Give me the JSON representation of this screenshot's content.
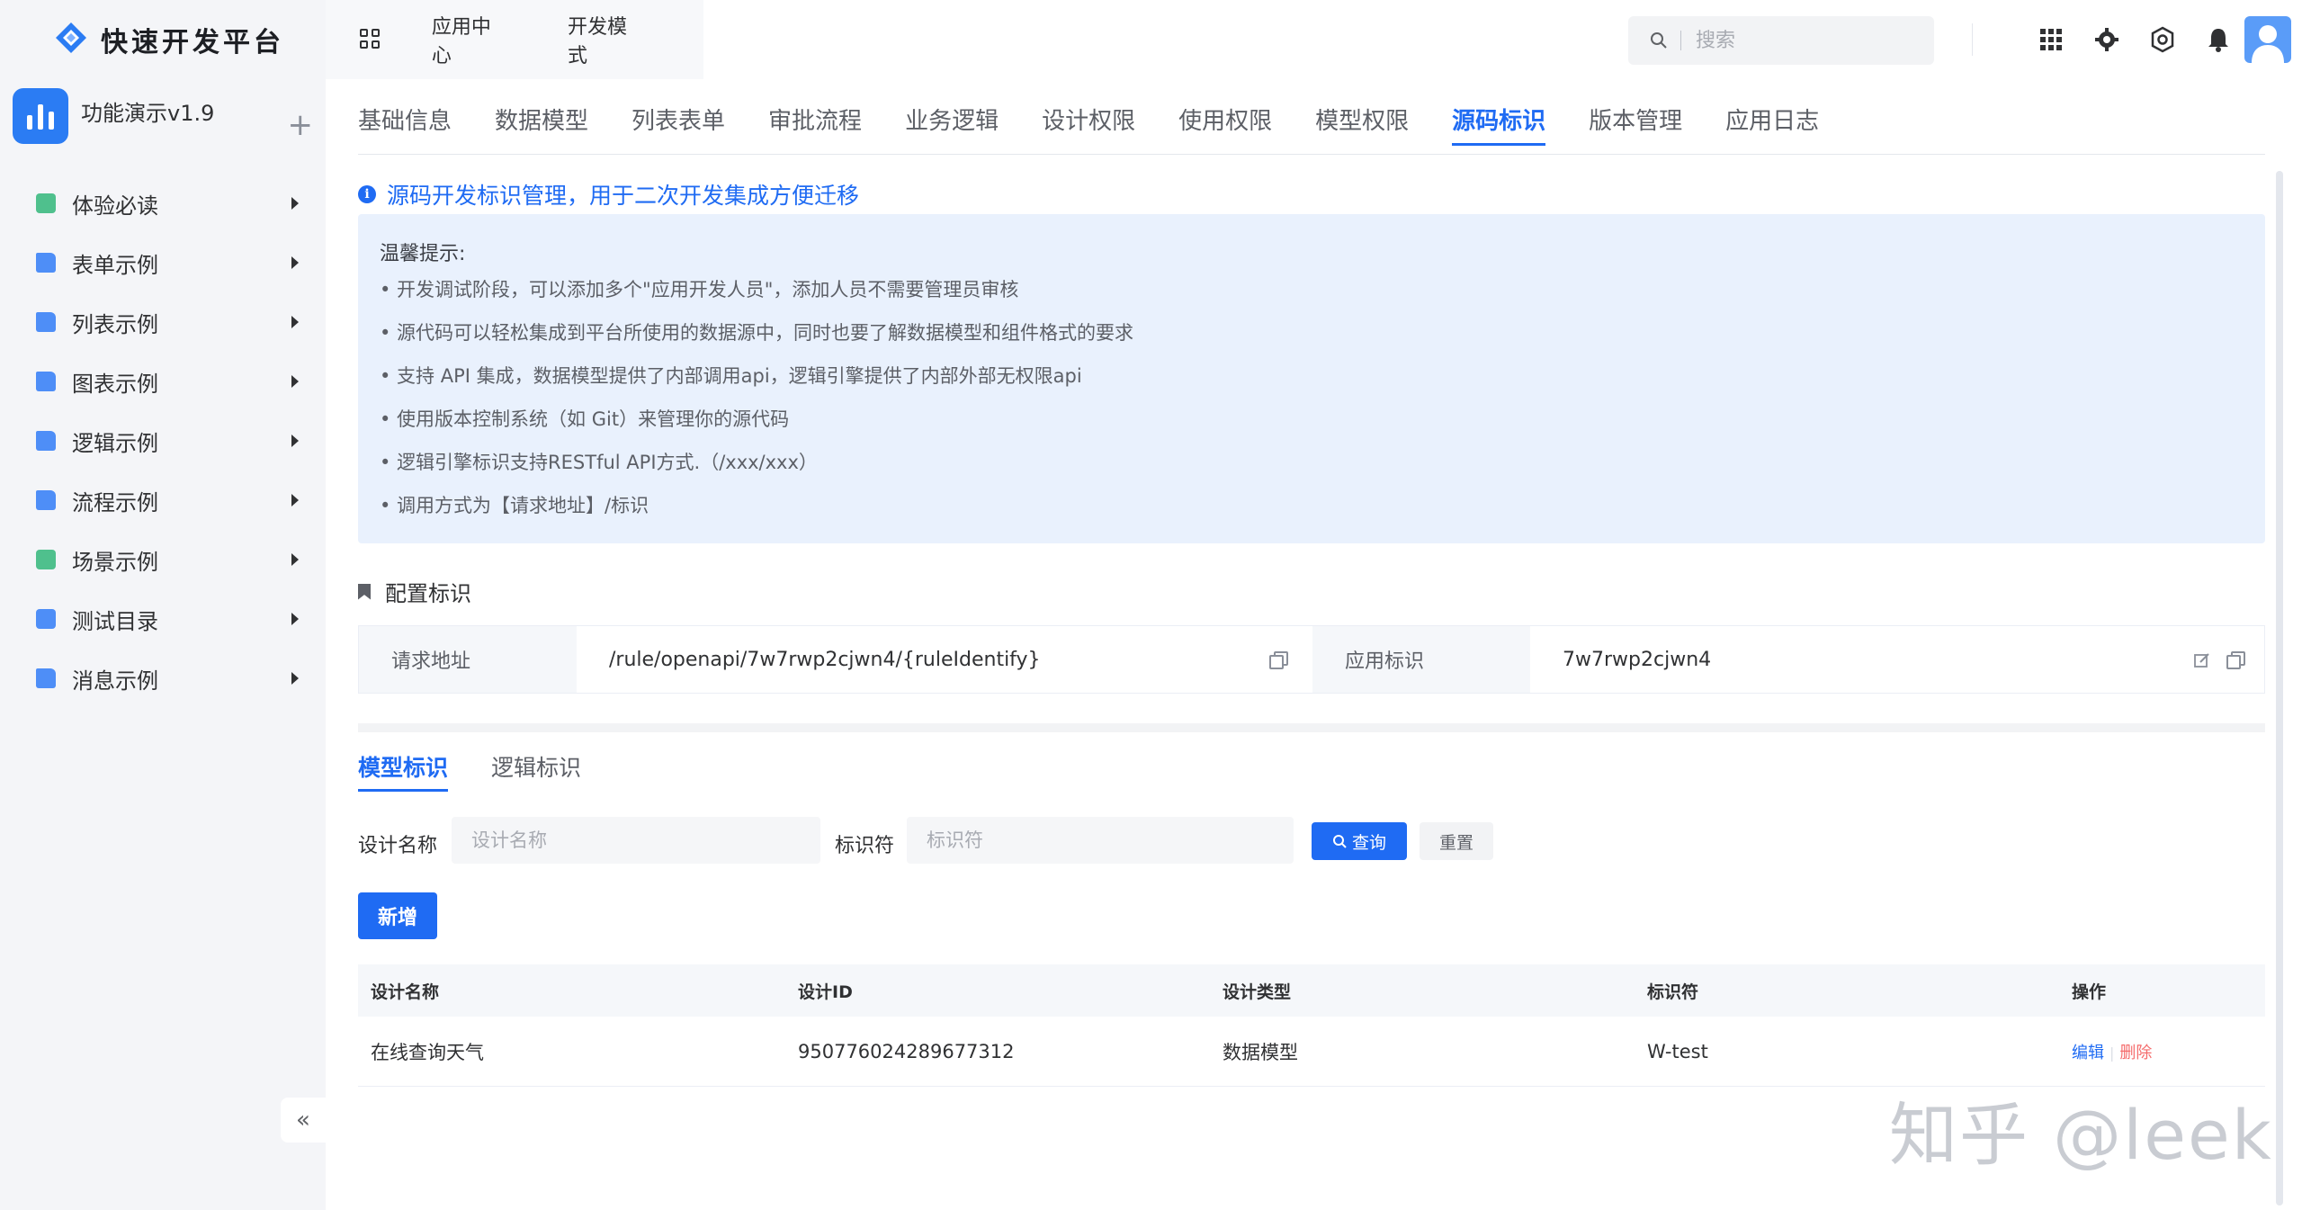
{
  "brand": {
    "name": "快速开发平台"
  },
  "app": {
    "name": "功能演示v1.9",
    "add_symbol": "+"
  },
  "sidebar": {
    "items": [
      {
        "label": "体验必读",
        "icon": "doc-green-icon",
        "color": "#4fc08d"
      },
      {
        "label": "表单示例",
        "icon": "folder-icon",
        "color": "#4e8ef7"
      },
      {
        "label": "列表示例",
        "icon": "folder-icon",
        "color": "#4e8ef7"
      },
      {
        "label": "图表示例",
        "icon": "folder-icon",
        "color": "#4e8ef7"
      },
      {
        "label": "逻辑示例",
        "icon": "folder-icon",
        "color": "#4e8ef7"
      },
      {
        "label": "流程示例",
        "icon": "folder-icon",
        "color": "#4e8ef7"
      },
      {
        "label": "场景示例",
        "icon": "doc-green-icon",
        "color": "#4fc08d"
      },
      {
        "label": "测试目录",
        "icon": "doc-blue-icon",
        "color": "#4e8ef7"
      },
      {
        "label": "消息示例",
        "icon": "folder-icon",
        "color": "#4e8ef7"
      }
    ],
    "collapse_symbol": "«"
  },
  "topnav": {
    "items": [
      "应用中心",
      "开发模式"
    ]
  },
  "search": {
    "placeholder": "搜索"
  },
  "tabs": [
    {
      "label": "基础信息",
      "active": false
    },
    {
      "label": "数据模型",
      "active": false
    },
    {
      "label": "列表表单",
      "active": false
    },
    {
      "label": "审批流程",
      "active": false
    },
    {
      "label": "业务逻辑",
      "active": false
    },
    {
      "label": "设计权限",
      "active": false
    },
    {
      "label": "使用权限",
      "active": false
    },
    {
      "label": "模型权限",
      "active": false
    },
    {
      "label": "源码标识",
      "active": true
    },
    {
      "label": "版本管理",
      "active": false
    },
    {
      "label": "应用日志",
      "active": false
    }
  ],
  "info": {
    "icon_glyph": "i",
    "title": "源码开发标识管理，用于二次开发集成方便迁移"
  },
  "notice": {
    "head": "温馨提示:",
    "lines": [
      "• 开发调试阶段，可以添加多个\"应用开发人员\"，添加人员不需要管理员审核",
      "• 源代码可以轻松集成到平台所使用的数据源中，同时也要了解数据模型和组件格式的要求",
      "• 支持 API 集成，数据模型提供了内部调用api，逻辑引擎提供了内部外部无权限api",
      "• 使用版本控制系统（如 Git）来管理你的源代码",
      "• 逻辑引擎标识支持RESTful API方式.（/xxx/xxx）",
      "• 调用方式为【请求地址】/标识"
    ]
  },
  "config": {
    "title": "配置标识",
    "request_label": "请求地址",
    "request_value": "/rule/openapi/7w7rwp2cjwn4/{ruleIdentify}",
    "app_label": "应用标识",
    "app_value": "7w7rwp2cjwn4"
  },
  "subtabs": [
    {
      "label": "模型标识",
      "active": true
    },
    {
      "label": "逻辑标识",
      "active": false
    }
  ],
  "filter": {
    "name_label": "设计名称",
    "name_placeholder": "设计名称",
    "id_label": "标识符",
    "id_placeholder": "标识符",
    "query_label": "查询",
    "reset_label": "重置"
  },
  "add_label": "新增",
  "table": {
    "columns": [
      "设计名称",
      "设计ID",
      "设计类型",
      "标识符",
      "操作"
    ],
    "rows": [
      {
        "name": "在线查询天气",
        "id": "950776024289677312",
        "type": "数据模型",
        "identifier": "W-test",
        "edit": "编辑",
        "delete": "删除"
      }
    ]
  },
  "watermark": "知乎 @leek",
  "colors": {
    "primary": "#1f6bf3",
    "danger": "#f56c6c",
    "notice_bg": "#e9f1fd",
    "sidebar_bg": "#f4f5f8"
  }
}
